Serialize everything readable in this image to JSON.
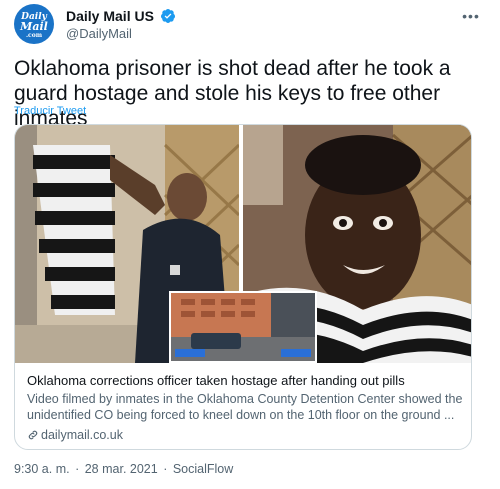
{
  "account": {
    "avatar_text_line1": "Daily",
    "avatar_text_line2": "Mail",
    "avatar_text_line3": ".com",
    "display_name": "Daily Mail US",
    "handle": "@DailyMail",
    "verified": true
  },
  "tweet": {
    "text": "Oklahoma prisoner is shot dead after he took a guard hostage and stole his keys to free other inmates",
    "translate_label": "Traducir Tweet"
  },
  "card": {
    "title": "Oklahoma corrections officer taken hostage after handing out pills",
    "description": "Video filmed by inmates in the Oklahoma County Detention Center showed the unidentified CO being forced to kneel down on the 10th floor on the ground ...",
    "domain": "dailymail.co.uk"
  },
  "meta": {
    "time": "9:30 a. m.",
    "date": "28 mar. 2021",
    "source": "SocialFlow",
    "separator": "·"
  },
  "icons": {
    "more": "more-options-icon",
    "verified": "verified-badge-icon",
    "link": "link-icon"
  },
  "colors": {
    "link_blue": "#1d9bf0",
    "secondary_text": "#536471",
    "avatar_blue": "#1a73c7",
    "border": "#cfd9de"
  }
}
